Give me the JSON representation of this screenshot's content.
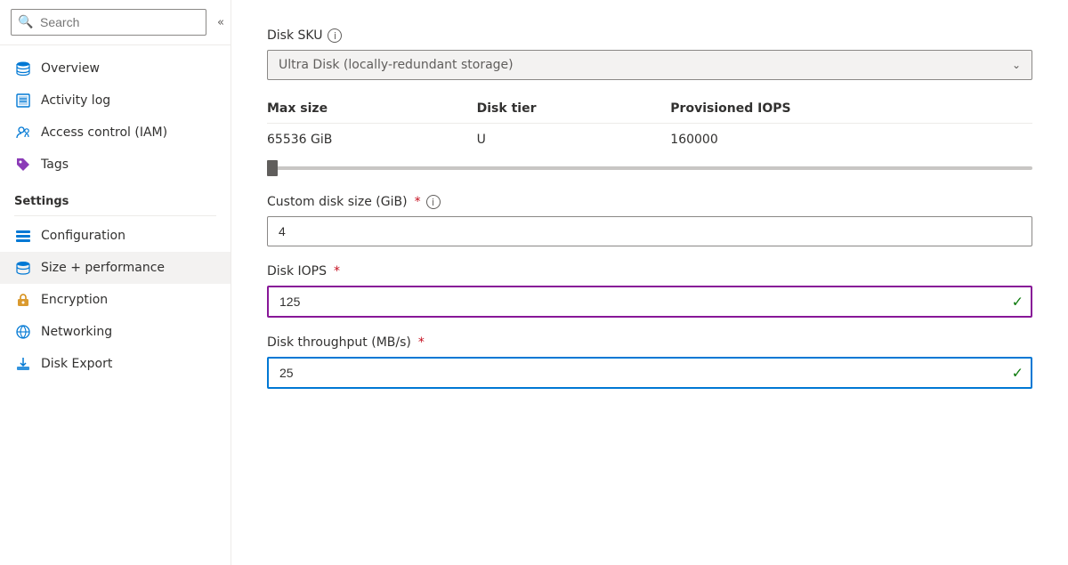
{
  "sidebar": {
    "search_placeholder": "Search",
    "collapse_label": "«",
    "nav_items": [
      {
        "id": "overview",
        "label": "Overview",
        "icon": "stack-icon",
        "active": false
      },
      {
        "id": "activity-log",
        "label": "Activity log",
        "icon": "activity-icon",
        "active": false
      },
      {
        "id": "access-control",
        "label": "Access control (IAM)",
        "icon": "access-icon",
        "active": false
      },
      {
        "id": "tags",
        "label": "Tags",
        "icon": "tags-icon",
        "active": false
      }
    ],
    "settings_label": "Settings",
    "settings_items": [
      {
        "id": "configuration",
        "label": "Configuration",
        "icon": "config-icon",
        "active": false
      },
      {
        "id": "size-performance",
        "label": "Size + performance",
        "icon": "size-icon",
        "active": true
      },
      {
        "id": "encryption",
        "label": "Encryption",
        "icon": "encryption-icon",
        "active": false
      },
      {
        "id": "networking",
        "label": "Networking",
        "icon": "networking-icon",
        "active": false
      },
      {
        "id": "disk-export",
        "label": "Disk Export",
        "icon": "disk-export-icon",
        "active": false
      }
    ]
  },
  "main": {
    "disk_sku": {
      "label": "Disk SKU",
      "value": "Ultra Disk (locally-redundant storage)"
    },
    "table": {
      "headers": [
        "Max size",
        "Disk tier",
        "Provisioned IOPS"
      ],
      "row": [
        "65536 GiB",
        "U",
        "160000"
      ]
    },
    "custom_disk_size": {
      "label": "Custom disk size (GiB)",
      "required": true,
      "value": "4"
    },
    "disk_iops": {
      "label": "Disk IOPS",
      "required": true,
      "value": "125"
    },
    "disk_throughput": {
      "label": "Disk throughput (MB/s)",
      "required": true,
      "value": "25"
    }
  }
}
